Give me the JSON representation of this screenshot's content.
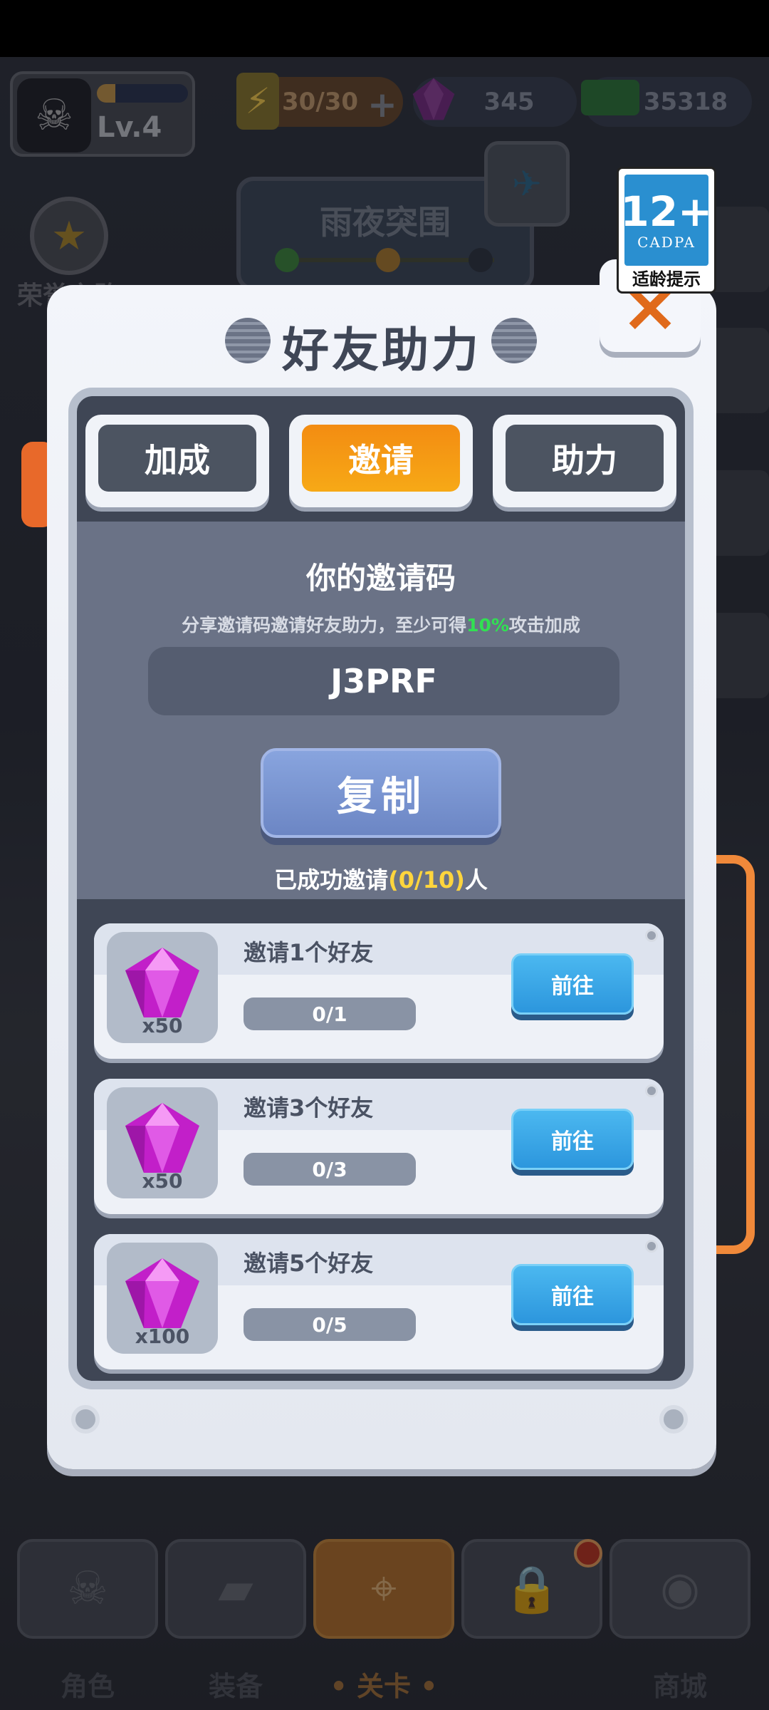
{
  "hud": {
    "level": "Lv.4",
    "xp_fraction": 0.2,
    "energy": "30/30",
    "gems": "345",
    "cash": "35318"
  },
  "background": {
    "honor_label": "荣誉之路",
    "stage_name": "雨夜突围"
  },
  "age_rating": {
    "rating": "12+",
    "org": "CADPA",
    "hint": "适龄提示"
  },
  "dialog": {
    "title": "好友助力",
    "close_icon": "×",
    "tabs": [
      {
        "label": "加成",
        "active": false
      },
      {
        "label": "邀请",
        "active": true
      },
      {
        "label": "助力",
        "active": false
      }
    ],
    "invite": {
      "heading": "你的邀请码",
      "desc_prefix": "分享邀请码邀请好友助力，至少可得",
      "desc_pct": "10%",
      "desc_suffix": "攻击加成",
      "code": "J3PRF",
      "copy_label": "复制",
      "count_prefix": "已成功邀请",
      "count_value": "(0/10)",
      "count_suffix": "人"
    },
    "tasks": [
      {
        "name": "邀请1个好友",
        "progress": "0/1",
        "reward_qty": "x50",
        "button": "前往"
      },
      {
        "name": "邀请3个好友",
        "progress": "0/3",
        "reward_qty": "x50",
        "button": "前往"
      },
      {
        "name": "邀请5个好友",
        "progress": "0/5",
        "reward_qty": "x100",
        "button": "前往"
      }
    ]
  },
  "bottom_nav": [
    {
      "label": "角色",
      "icon": "skull-icon"
    },
    {
      "label": "装备",
      "icon": "gun-icon"
    },
    {
      "label": "• 关卡 •",
      "icon": "map-pin-icon",
      "active": true
    },
    {
      "label": "",
      "icon": "lock-icon"
    },
    {
      "label": "商城",
      "icon": "shop-icon"
    }
  ],
  "colors": {
    "accent_orange": "#f5a013",
    "go_blue": "#2c96dd",
    "highlight_green": "#31e052",
    "highlight_yellow": "#ffd53d"
  }
}
